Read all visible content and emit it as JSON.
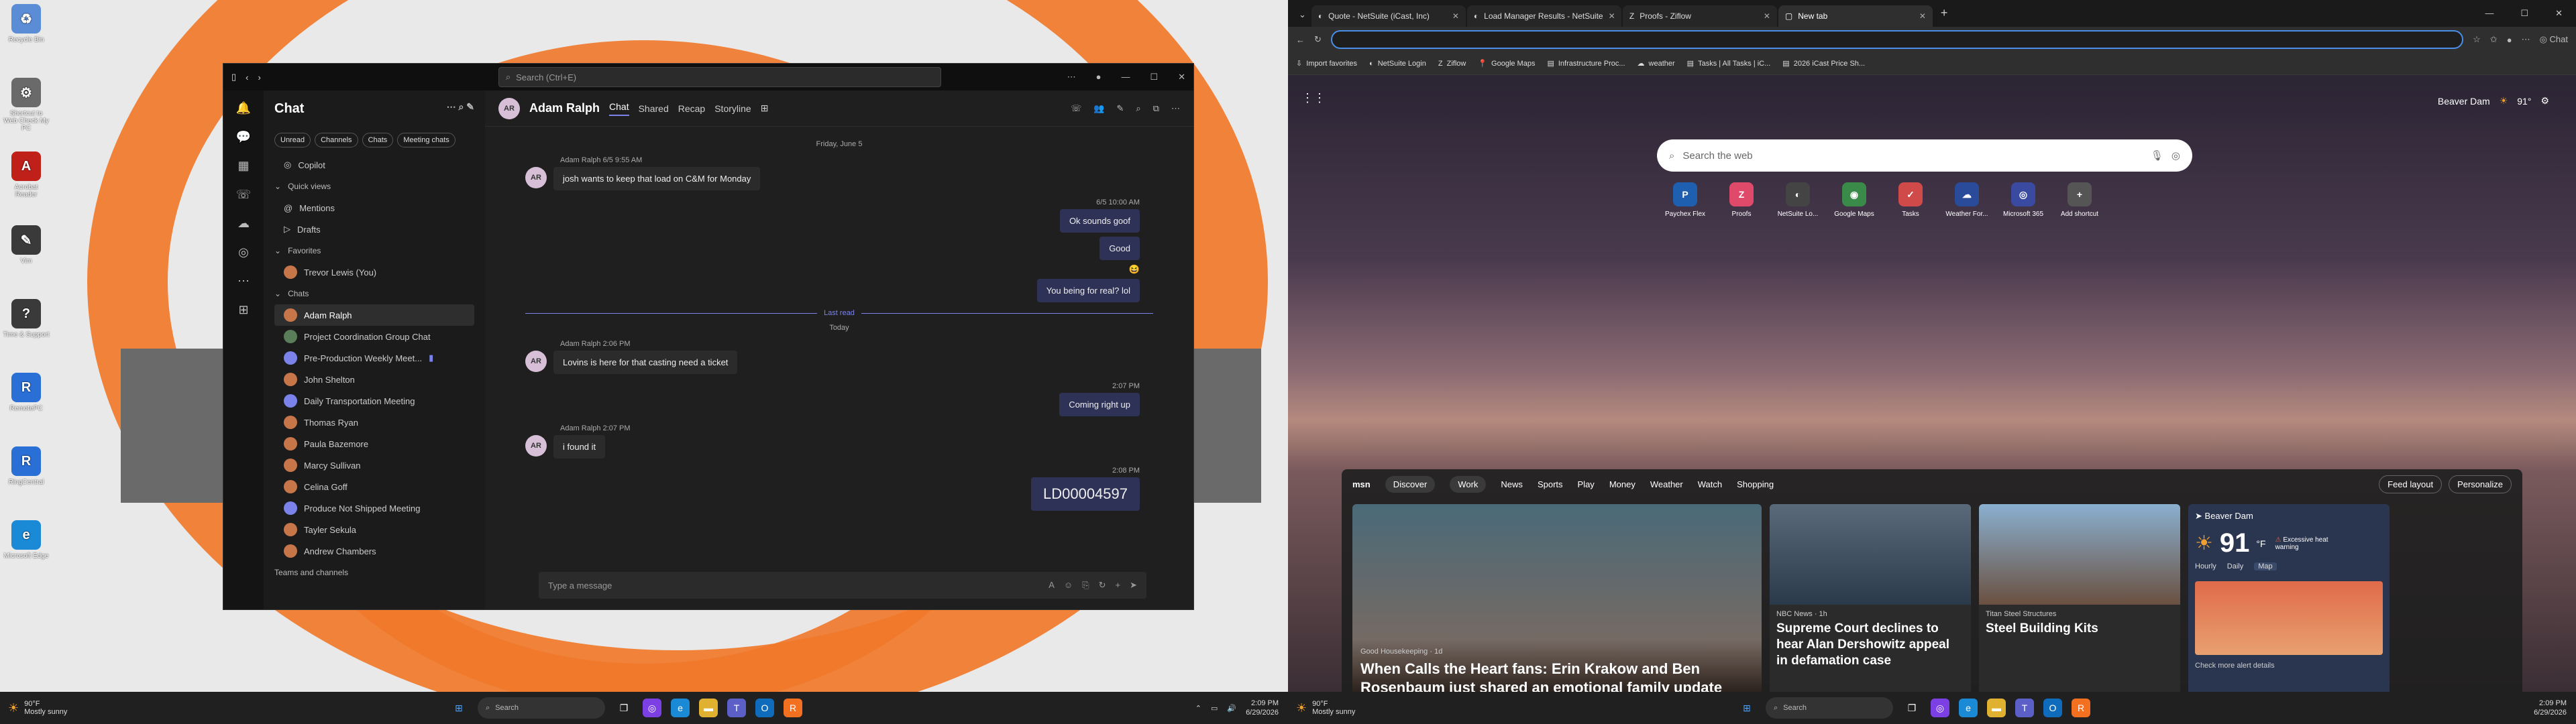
{
  "desktop": {
    "icons": [
      {
        "label": "Recycle Bin",
        "color": "#5b8dd6"
      },
      {
        "label": "Shortcut to Web Check My PC",
        "color": "#6a6a6a"
      },
      {
        "label": "Acrobat Reader",
        "color": "#c0201a"
      },
      {
        "label": "Vim",
        "color": "#3a3a3a"
      },
      {
        "label": "Time & Support",
        "color": "#3a3a3a"
      },
      {
        "label": "RemotePC",
        "color": "#2a6fd6"
      },
      {
        "label": "RingCentral",
        "color": "#2a6fd6"
      },
      {
        "label": "Microsoft Edge",
        "color": "#1a8ad6"
      }
    ]
  },
  "teams": {
    "search_placeholder": "Search (Ctrl+E)",
    "chat_title": "Chat",
    "filters": [
      "Unread",
      "Channels",
      "Chats",
      "Meeting chats"
    ],
    "copilot": "Copilot",
    "quick_views": "Quick views",
    "mentions": "Mentions",
    "drafts": "Drafts",
    "favorites": "Favorites",
    "fav_item": "Trevor Lewis (You)",
    "chats_label": "Chats",
    "chats": [
      "Adam Ralph",
      "Project Coordination Group Chat",
      "Pre-Production Weekly Meet...",
      "John Shelton",
      "Daily Transportation Meeting",
      "Thomas Ryan",
      "Paula Bazemore",
      "Marcy Sullivan",
      "Celina Goff",
      "Produce Not Shipped Meeting",
      "Tayler Sekula",
      "Andrew Chambers"
    ],
    "teams_channels": "Teams and channels",
    "contact": "Adam Ralph",
    "tabs": [
      "Chat",
      "Shared",
      "Recap",
      "Storyline"
    ],
    "day1": "Friday, June 5",
    "m1_meta": "Adam Ralph  6/5 9:55 AM",
    "m1_text": "josh wants to keep that load on C&M for Monday",
    "o1_meta": "6/5 10:00 AM",
    "o1_a": "Ok sounds goof",
    "o1_b": "Good",
    "o1_c": "You being for real? lol",
    "last_read": "Last read",
    "today": "Today",
    "m2_meta": "Adam Ralph  2:06 PM",
    "m2_text": "Lovins is here for that casting need a ticket",
    "o2_meta": "2:07 PM",
    "o2_text": "Coming right up",
    "m3_meta": "Adam Ralph  2:07 PM",
    "m3_text": "i found it",
    "o3_meta": "2:08 PM",
    "o3_text": "LD00004597",
    "compose": "Type a message",
    "avatar_initials": "AR"
  },
  "taskbar": {
    "weather_temp": "90°F",
    "weather_desc": "Mostly sunny",
    "search": "Search",
    "time": "2:09 PM",
    "date": "6/29/2026"
  },
  "edge": {
    "tabs": [
      "Quote - NetSuite (iCast, Inc)",
      "Load Manager Results - NetSuite",
      "Proofs - Ziflow",
      "New tab"
    ],
    "favorites": [
      "Import favorites",
      "NetSuite Login",
      "Ziflow",
      "Google Maps",
      "Infrastructure Proc...",
      "weather",
      "Tasks | All Tasks | iC...",
      "2026 iCast Price Sh..."
    ],
    "chat": "Chat",
    "location": "Beaver Dam",
    "temp": "91°",
    "search_placeholder": "Search the web",
    "quicklinks": [
      "Paychex Flex",
      "Proofs",
      "NetSuite Lo...",
      "Google Maps",
      "Tasks",
      "Weather For...",
      "Microsoft 365",
      "Add shortcut"
    ],
    "msn_tabs": [
      "Discover",
      "Work",
      "News",
      "Sports",
      "Play",
      "Money",
      "Weather",
      "Watch",
      "Shopping"
    ],
    "feed_layout": "Feed layout",
    "personalize": "Personalize",
    "card1_src": "Good Housekeeping · 1d",
    "card1_title": "When Calls the Heart fans: Erin Krakow and Ben Rosenbaum just shared an emotional family update",
    "card2_src": "NBC News · 1h",
    "card2_title": "Supreme Court declines to hear Alan Dershowitz appeal in defamation case",
    "card3_src": "Titan Steel Structures",
    "card3_title": "Steel Building Kits",
    "wx_loc": "Beaver Dam",
    "wx_temp": "91",
    "wx_unit": "°F",
    "wx_alert": "Excessive heat warning",
    "wx_tabs": [
      "Hourly",
      "Daily",
      "Map"
    ],
    "wx_more": "Check more alert details"
  }
}
